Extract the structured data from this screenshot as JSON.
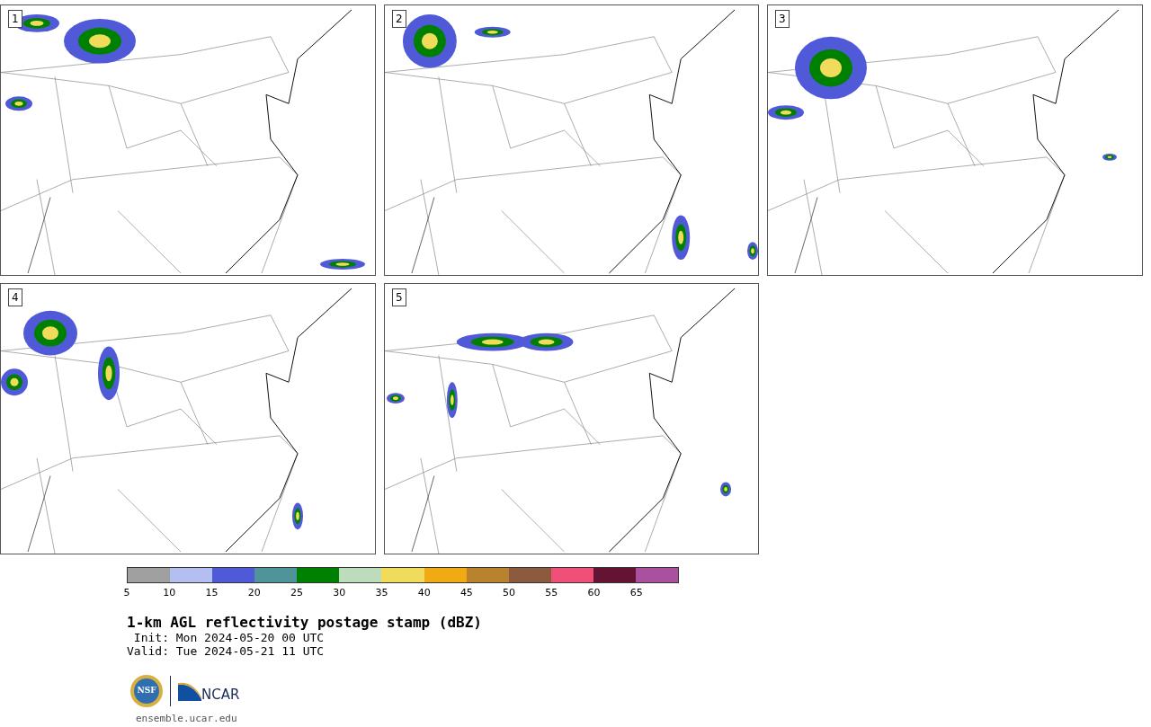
{
  "panels": [
    {
      "label": "1"
    },
    {
      "label": "2"
    },
    {
      "label": "3"
    },
    {
      "label": "4"
    },
    {
      "label": "5"
    }
  ],
  "colorbar": {
    "segments": [
      {
        "color": "#a0a0a0"
      },
      {
        "color": "#b4bef0"
      },
      {
        "color": "#505ad8"
      },
      {
        "color": "#4e9499"
      },
      {
        "color": "#008000"
      },
      {
        "color": "#bcdcbc"
      },
      {
        "color": "#f0dc5a"
      },
      {
        "color": "#f0aa14"
      },
      {
        "color": "#b9822e"
      },
      {
        "color": "#8c5a3c"
      },
      {
        "color": "#f05078"
      },
      {
        "color": "#641432"
      },
      {
        "color": "#aa50a0"
      }
    ],
    "ticks": [
      "5",
      "10",
      "15",
      "20",
      "25",
      "30",
      "35",
      "40",
      "45",
      "50",
      "55",
      "60",
      "65"
    ]
  },
  "title": "1-km AGL reflectivity postage stamp (dBZ)",
  "init": " Init: Mon 2024-05-20 00 UTC",
  "valid": "Valid: Tue 2024-05-21 11 UTC",
  "logos": {
    "nsf": "NSF",
    "ncar": "NCAR"
  },
  "site": "ensemble.ucar.edu"
}
